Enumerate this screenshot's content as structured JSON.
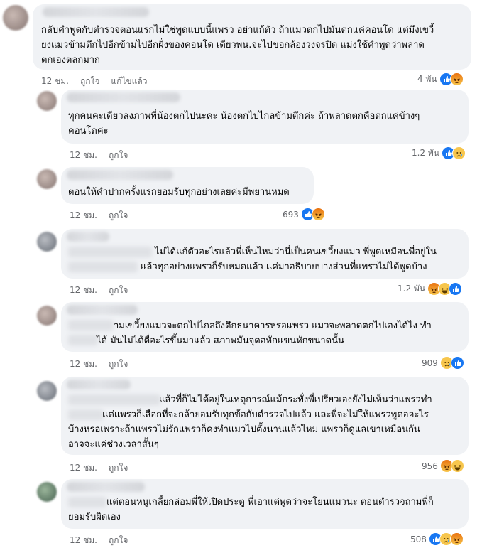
{
  "comments": [
    {
      "lines": [
        "กลับคำพูดกับตำรวจตอนแรกไม่ใช่พูดแบบนี้แพรว อย่าแก้ตัว ถ้าแมวตกไปมันตกแค่คอนโด แต่มึงเขวี้",
        "ยงแมวข้ามตึกไปอีกข้ามไปอีกฝั่งของคอนโด เดียวพน.จะไปขอกล้องวงจรปิด แม่งใช้คำพูดว่าพลาด",
        "ตกเองตลกมาก"
      ],
      "time": "12 ชม.",
      "like_label": "ถูกใจ",
      "edited_label": "แก้ไขแล้ว",
      "reaction_count": "4 พัน",
      "reactions": [
        "like-icon",
        "angry-icon"
      ]
    },
    {
      "lines": [
        "ทุกคนคะเดียวลงภาพที่น้องตกไปนะคะ น้องตกไปไกลข้ามตึกค่ะ ถ้าพลาดตกคือตกแค่ข้างๆ",
        "คอนโดค่ะ"
      ],
      "time": "12 ชม.",
      "like_label": "ถูกใจ",
      "reaction_count": "1.2 พัน",
      "reactions": [
        "like-icon",
        "sad-icon"
      ]
    },
    {
      "lines": [
        "ตอนให้คำปากครั้งแรกยอมรับทุกอย่างเลยค่ะมีพยานหมด"
      ],
      "time": "12 ชม.",
      "like_label": "ถูกใจ",
      "reaction_count": "693",
      "reactions": [
        "like-icon",
        "angry-icon"
      ]
    },
    {
      "lines": [
        "ไม่ได้แก้ตัวอะไรแล้วพี่เห็นไหมว่านี่เป็นคนเขวี้ยงแมว พี่พูดเหมือนพี่อยู่ใน",
        "แล้วทุกอย่างแพรวก็รับหมดแล้ว แค่มาอธิบายบางส่วนที่แพรวไม่ได้พูดบ้าง"
      ],
      "time": "12 ชม.",
      "like_label": "ถูกใจ",
      "reaction_count": "1.2 พัน",
      "reactions": [
        "angry-icon",
        "haha-icon",
        "like-icon"
      ]
    },
    {
      "lines": [
        "ามเขวี้ยงแมวจะตกไปไกลถึงตึกธนาคารหรอแพรว แมวจะพลาดตกไปเองได้ไง ทำ",
        "ได้ มันไม่ได้ตื่อะไรขึ้นมาแล้ว สภาพมันจุดอหักแขนหักขนาดนั้น"
      ],
      "time": "12 ชม.",
      "like_label": "ถูกใจ",
      "reaction_count": "909",
      "reactions": [
        "sad-icon",
        "like-icon"
      ]
    },
    {
      "lines": [
        "แล้วพี่ก็ไม่ได้อยู่ในเหตุการณ์แม้กระทั่งพี่เปรียวเองยังไม่เห็นว่าแพรวทำ",
        "แต่แพรวก็เลือกที่จะกล้ายอมรับทุกข้อกับตำรวจไปแล้ว และพี่จะไม่ให้แพรวพูดออะไร",
        "บ้างหรอเพราะถ้าแพรวไม่รักแพรวก็คงทำแมวไปตั้งนานแล้วไหม แพรวก็ดูแลเขาเหมือนกัน",
        "อาจจะแค่ช่วงเวลาสั้นๆ"
      ],
      "time": "12 ชม.",
      "like_label": "ถูกใจ",
      "reaction_count": "956",
      "reactions": [
        "angry-icon",
        "haha-icon"
      ]
    },
    {
      "lines": [
        "แต่ตอนหนูเกลี้ยกล่อมพี่ให้เปิดประตู พี่เอาแต่พูดว่าจะโยนแมวนะ ตอนตำรวจถามพี่ก็",
        "ยอมรับผิดเอง"
      ],
      "time": "12 ชม.",
      "like_label": "ถูกใจ",
      "reaction_count": "508",
      "reactions": [
        "like-icon",
        "sad-icon",
        "angry-icon"
      ]
    }
  ]
}
